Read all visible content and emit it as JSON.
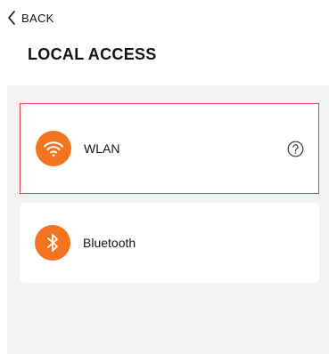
{
  "header": {
    "back_label": "BACK",
    "back_icon": "chevron-left-icon",
    "title": "LOCAL ACCESS"
  },
  "options": [
    {
      "label": "WLAN",
      "icon": "wifi-icon",
      "selected": true,
      "has_help": true
    },
    {
      "label": "Bluetooth",
      "icon": "bluetooth-icon",
      "selected": false,
      "has_help": false
    }
  ],
  "colors": {
    "accent": "#f3731e",
    "selection_border": "#e5414b",
    "panel_background": "#f3f3f6"
  }
}
